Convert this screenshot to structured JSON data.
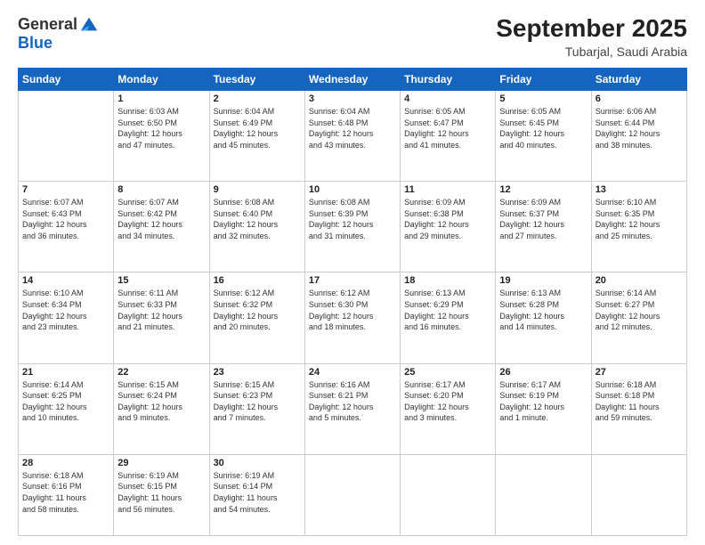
{
  "header": {
    "logo_line1": "General",
    "logo_line2": "Blue",
    "month": "September 2025",
    "location": "Tubarjal, Saudi Arabia"
  },
  "days_of_week": [
    "Sunday",
    "Monday",
    "Tuesday",
    "Wednesday",
    "Thursday",
    "Friday",
    "Saturday"
  ],
  "weeks": [
    [
      {
        "day": "",
        "info": ""
      },
      {
        "day": "1",
        "info": "Sunrise: 6:03 AM\nSunset: 6:50 PM\nDaylight: 12 hours\nand 47 minutes."
      },
      {
        "day": "2",
        "info": "Sunrise: 6:04 AM\nSunset: 6:49 PM\nDaylight: 12 hours\nand 45 minutes."
      },
      {
        "day": "3",
        "info": "Sunrise: 6:04 AM\nSunset: 6:48 PM\nDaylight: 12 hours\nand 43 minutes."
      },
      {
        "day": "4",
        "info": "Sunrise: 6:05 AM\nSunset: 6:47 PM\nDaylight: 12 hours\nand 41 minutes."
      },
      {
        "day": "5",
        "info": "Sunrise: 6:05 AM\nSunset: 6:45 PM\nDaylight: 12 hours\nand 40 minutes."
      },
      {
        "day": "6",
        "info": "Sunrise: 6:06 AM\nSunset: 6:44 PM\nDaylight: 12 hours\nand 38 minutes."
      }
    ],
    [
      {
        "day": "7",
        "info": "Sunrise: 6:07 AM\nSunset: 6:43 PM\nDaylight: 12 hours\nand 36 minutes."
      },
      {
        "day": "8",
        "info": "Sunrise: 6:07 AM\nSunset: 6:42 PM\nDaylight: 12 hours\nand 34 minutes."
      },
      {
        "day": "9",
        "info": "Sunrise: 6:08 AM\nSunset: 6:40 PM\nDaylight: 12 hours\nand 32 minutes."
      },
      {
        "day": "10",
        "info": "Sunrise: 6:08 AM\nSunset: 6:39 PM\nDaylight: 12 hours\nand 31 minutes."
      },
      {
        "day": "11",
        "info": "Sunrise: 6:09 AM\nSunset: 6:38 PM\nDaylight: 12 hours\nand 29 minutes."
      },
      {
        "day": "12",
        "info": "Sunrise: 6:09 AM\nSunset: 6:37 PM\nDaylight: 12 hours\nand 27 minutes."
      },
      {
        "day": "13",
        "info": "Sunrise: 6:10 AM\nSunset: 6:35 PM\nDaylight: 12 hours\nand 25 minutes."
      }
    ],
    [
      {
        "day": "14",
        "info": "Sunrise: 6:10 AM\nSunset: 6:34 PM\nDaylight: 12 hours\nand 23 minutes."
      },
      {
        "day": "15",
        "info": "Sunrise: 6:11 AM\nSunset: 6:33 PM\nDaylight: 12 hours\nand 21 minutes."
      },
      {
        "day": "16",
        "info": "Sunrise: 6:12 AM\nSunset: 6:32 PM\nDaylight: 12 hours\nand 20 minutes."
      },
      {
        "day": "17",
        "info": "Sunrise: 6:12 AM\nSunset: 6:30 PM\nDaylight: 12 hours\nand 18 minutes."
      },
      {
        "day": "18",
        "info": "Sunrise: 6:13 AM\nSunset: 6:29 PM\nDaylight: 12 hours\nand 16 minutes."
      },
      {
        "day": "19",
        "info": "Sunrise: 6:13 AM\nSunset: 6:28 PM\nDaylight: 12 hours\nand 14 minutes."
      },
      {
        "day": "20",
        "info": "Sunrise: 6:14 AM\nSunset: 6:27 PM\nDaylight: 12 hours\nand 12 minutes."
      }
    ],
    [
      {
        "day": "21",
        "info": "Sunrise: 6:14 AM\nSunset: 6:25 PM\nDaylight: 12 hours\nand 10 minutes."
      },
      {
        "day": "22",
        "info": "Sunrise: 6:15 AM\nSunset: 6:24 PM\nDaylight: 12 hours\nand 9 minutes."
      },
      {
        "day": "23",
        "info": "Sunrise: 6:15 AM\nSunset: 6:23 PM\nDaylight: 12 hours\nand 7 minutes."
      },
      {
        "day": "24",
        "info": "Sunrise: 6:16 AM\nSunset: 6:21 PM\nDaylight: 12 hours\nand 5 minutes."
      },
      {
        "day": "25",
        "info": "Sunrise: 6:17 AM\nSunset: 6:20 PM\nDaylight: 12 hours\nand 3 minutes."
      },
      {
        "day": "26",
        "info": "Sunrise: 6:17 AM\nSunset: 6:19 PM\nDaylight: 12 hours\nand 1 minute."
      },
      {
        "day": "27",
        "info": "Sunrise: 6:18 AM\nSunset: 6:18 PM\nDaylight: 11 hours\nand 59 minutes."
      }
    ],
    [
      {
        "day": "28",
        "info": "Sunrise: 6:18 AM\nSunset: 6:16 PM\nDaylight: 11 hours\nand 58 minutes."
      },
      {
        "day": "29",
        "info": "Sunrise: 6:19 AM\nSunset: 6:15 PM\nDaylight: 11 hours\nand 56 minutes."
      },
      {
        "day": "30",
        "info": "Sunrise: 6:19 AM\nSunset: 6:14 PM\nDaylight: 11 hours\nand 54 minutes."
      },
      {
        "day": "",
        "info": ""
      },
      {
        "day": "",
        "info": ""
      },
      {
        "day": "",
        "info": ""
      },
      {
        "day": "",
        "info": ""
      }
    ]
  ]
}
